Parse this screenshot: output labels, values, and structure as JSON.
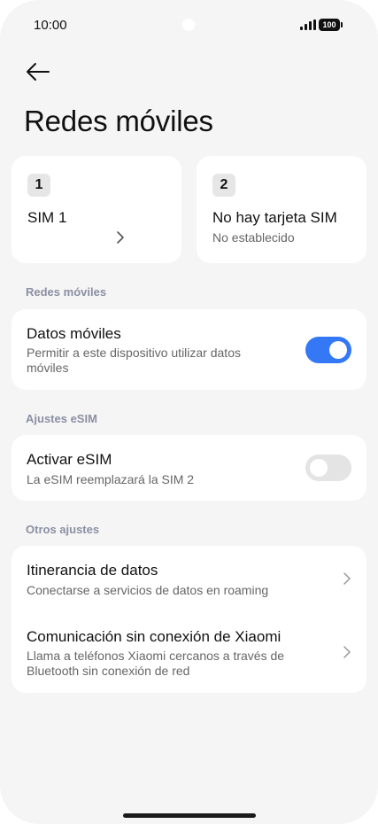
{
  "status_bar": {
    "time": "10:00",
    "battery": "100"
  },
  "header": {
    "title": "Redes móviles"
  },
  "sim_cards": [
    {
      "number": "1",
      "name": "SIM 1",
      "subtitle": ""
    },
    {
      "number": "2",
      "name": "No hay tarjeta SIM",
      "subtitle": "No establecido"
    }
  ],
  "sections": {
    "mobile_networks": {
      "label": "Redes móviles",
      "mobile_data": {
        "title": "Datos móviles",
        "subtitle": "Permitir a este dispositivo utilizar datos móviles",
        "enabled": true
      }
    },
    "esim": {
      "label": "Ajustes eSIM",
      "activate": {
        "title": "Activar eSIM",
        "subtitle": "La eSIM reemplazará la SIM 2",
        "enabled": false
      }
    },
    "other": {
      "label": "Otros ajustes",
      "roaming": {
        "title": "Itinerancia de datos",
        "subtitle": "Conectarse a servicios de datos en roaming"
      },
      "offline_comm": {
        "title": "Comunicación sin conexión de Xiaomi",
        "subtitle": "Llama a teléfonos Xiaomi cercanos a través de Bluetooth sin conexión de red"
      }
    }
  },
  "colors": {
    "accent": "#3478f6",
    "background": "#f5f5f5",
    "section_label": "#8b8fa3"
  },
  "icons": {
    "back": "arrow-left-icon",
    "chevron": "chevron-right-icon"
  }
}
